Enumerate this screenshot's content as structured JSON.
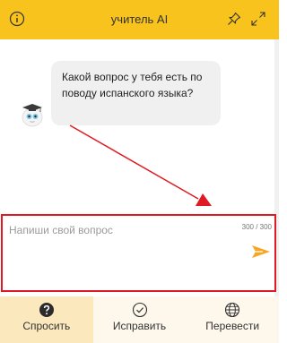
{
  "header": {
    "title": "учитель AI",
    "icons": [
      "info-icon",
      "pin-icon",
      "expand-icon"
    ]
  },
  "chat": {
    "messages": [
      {
        "role": "assistant",
        "text": "Какой вопрос у тебя есть по поводу испанского языка?"
      }
    ]
  },
  "input": {
    "placeholder": "Напиши свой вопрос",
    "value": "",
    "counter": "300 / 300"
  },
  "tabs": [
    {
      "label": "Спросить",
      "icon": "question-icon",
      "active": true
    },
    {
      "label": "Исправить",
      "icon": "check-icon",
      "active": false
    },
    {
      "label": "Перевести",
      "icon": "globe-icon",
      "active": false
    }
  ],
  "colors": {
    "header": "#f8c31c",
    "accent": "#f5a623",
    "annotation": "#e01a22",
    "active_tab": "#fbe9bd"
  }
}
